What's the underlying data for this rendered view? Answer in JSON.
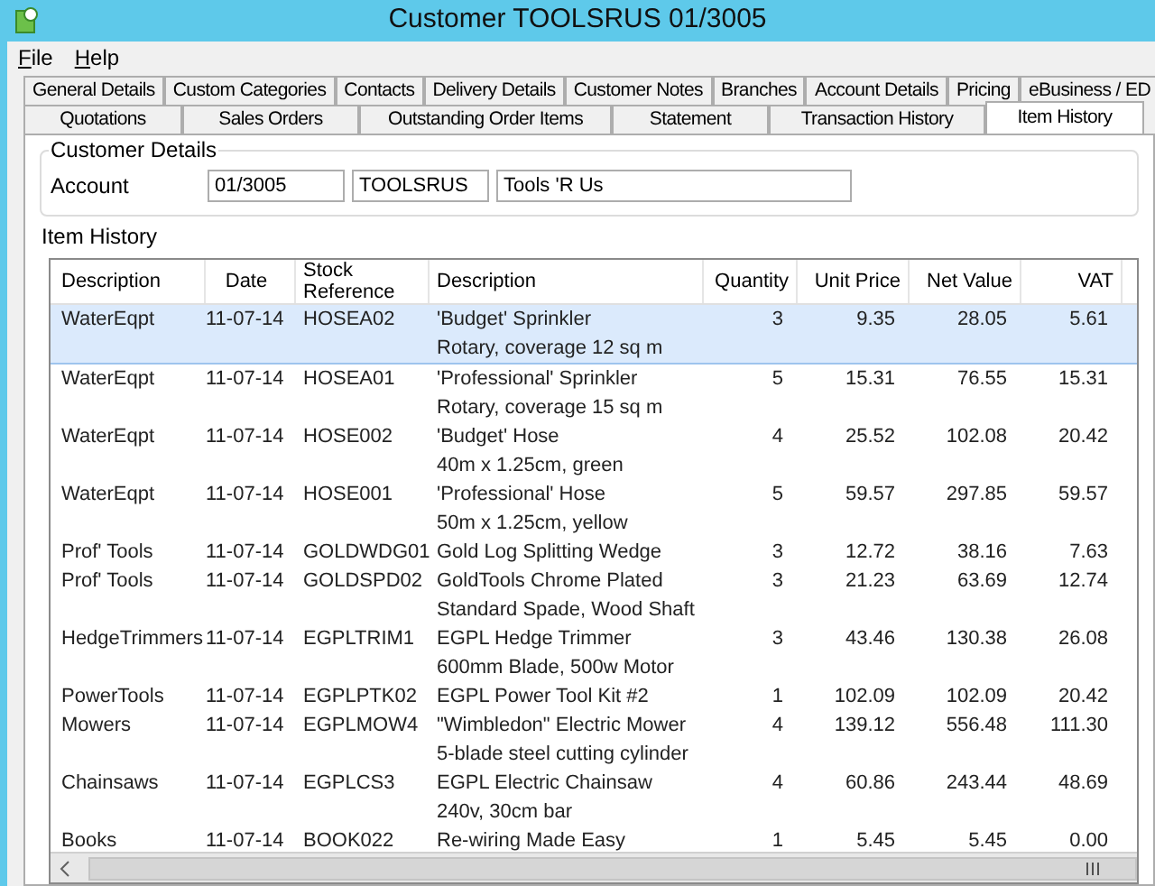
{
  "window": {
    "title": "Customer TOOLSRUS 01/3005"
  },
  "menu": [
    "File",
    "Help"
  ],
  "tab_rows": [
    [
      {
        "label": "General Details",
        "selected": false
      },
      {
        "label": "Custom Categories",
        "selected": false
      },
      {
        "label": "Contacts",
        "selected": false
      },
      {
        "label": "Delivery Details",
        "selected": false
      },
      {
        "label": "Customer Notes",
        "selected": false
      },
      {
        "label": "Branches",
        "selected": false
      },
      {
        "label": "Account Details",
        "selected": false
      },
      {
        "label": "Pricing",
        "selected": false
      },
      {
        "label": "eBusiness / ED",
        "selected": false
      }
    ],
    [
      {
        "label": "Quotations",
        "selected": false
      },
      {
        "label": "Sales Orders",
        "selected": false
      },
      {
        "label": "Outstanding Order Items",
        "selected": false
      },
      {
        "label": "Statement",
        "selected": false
      },
      {
        "label": "Transaction History",
        "selected": false
      },
      {
        "label": "Item History",
        "selected": true
      }
    ]
  ],
  "customer_details": {
    "title": "Customer Details",
    "label": "Account",
    "fields": [
      "01/3005",
      "TOOLSRUS",
      "Tools 'R Us"
    ]
  },
  "item_history": {
    "title": "Item History",
    "columns": [
      "Description",
      "Date",
      "Stock Reference",
      "Description",
      "Quantity",
      "Unit Price",
      "Net Value",
      "VAT"
    ],
    "rows": [
      {
        "selected": true,
        "cells": [
          "WaterEqpt",
          "11-07-14",
          "HOSEA02",
          "'Budget' Sprinkler",
          "3",
          "9.35",
          "28.05",
          "5.61"
        ],
        "detail": "Rotary, coverage 12 sq m"
      },
      {
        "selected": false,
        "cells": [
          "WaterEqpt",
          "11-07-14",
          "HOSEA01",
          "'Professional' Sprinkler",
          "5",
          "15.31",
          "76.55",
          "15.31"
        ],
        "detail": "Rotary, coverage 15 sq m"
      },
      {
        "selected": false,
        "cells": [
          "WaterEqpt",
          "11-07-14",
          "HOSE002",
          "'Budget' Hose",
          "4",
          "25.52",
          "102.08",
          "20.42"
        ],
        "detail": "40m x 1.25cm, green"
      },
      {
        "selected": false,
        "cells": [
          "WaterEqpt",
          "11-07-14",
          "HOSE001",
          "'Professional' Hose",
          "5",
          "59.57",
          "297.85",
          "59.57"
        ],
        "detail": "50m x 1.25cm, yellow"
      },
      {
        "selected": false,
        "cells": [
          "Prof' Tools",
          "11-07-14",
          "GOLDWDG01",
          "Gold Log Splitting Wedge",
          "3",
          "12.72",
          "38.16",
          "7.63"
        ]
      },
      {
        "selected": false,
        "cells": [
          "Prof' Tools",
          "11-07-14",
          "GOLDSPD02",
          "GoldTools Chrome Plated",
          "3",
          "21.23",
          "63.69",
          "12.74"
        ],
        "detail": "Standard Spade, Wood Shaft"
      },
      {
        "selected": false,
        "cells": [
          "HedgeTrimmers",
          "11-07-14",
          "EGPLTRIM1",
          "EGPL Hedge Trimmer",
          "3",
          "43.46",
          "130.38",
          "26.08"
        ],
        "detail": "600mm Blade, 500w Motor"
      },
      {
        "selected": false,
        "cells": [
          "PowerTools",
          "11-07-14",
          "EGPLPTK02",
          "EGPL Power Tool Kit #2",
          "1",
          "102.09",
          "102.09",
          "20.42"
        ]
      },
      {
        "selected": false,
        "cells": [
          "Mowers",
          "11-07-14",
          "EGPLMOW4",
          "\"Wimbledon\" Electric Mower",
          "4",
          "139.12",
          "556.48",
          "111.30"
        ],
        "detail": "5-blade steel cutting cylinder"
      },
      {
        "selected": false,
        "cells": [
          "Chainsaws",
          "11-07-14",
          "EGPLCS3",
          "EGPL Electric Chainsaw",
          "4",
          "60.86",
          "243.44",
          "48.69"
        ],
        "detail": "240v, 30cm bar"
      },
      {
        "selected": false,
        "cells": [
          "Books",
          "11-07-14",
          "BOOK022",
          "Re-wiring Made Easy",
          "1",
          "5.45",
          "5.45",
          "0.00"
        ]
      }
    ]
  }
}
